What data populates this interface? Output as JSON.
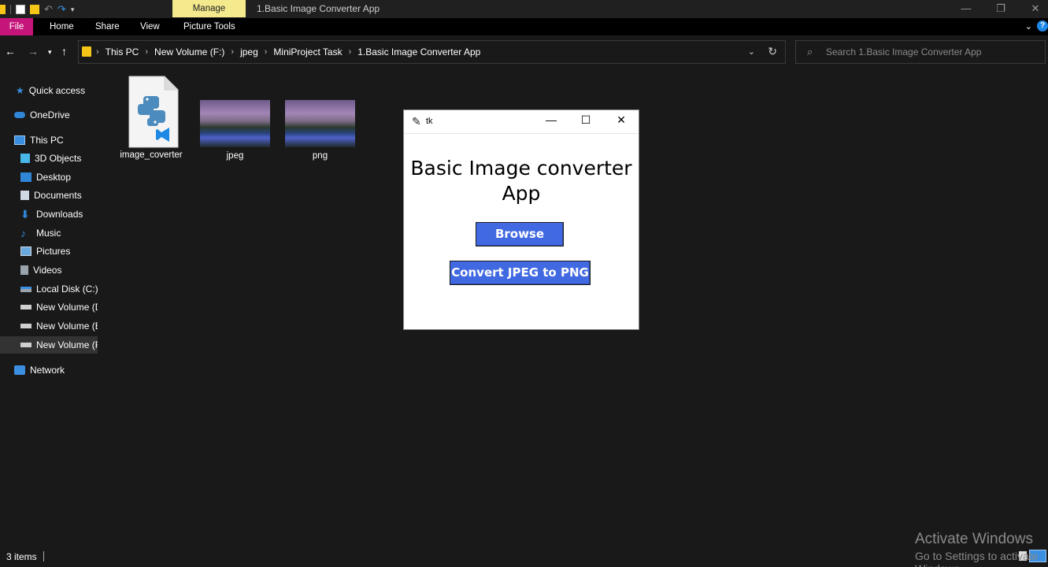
{
  "titlebar": {
    "manage_tab": "Manage",
    "window_title": "1.Basic Image Converter App",
    "minimize": "—",
    "restore": "❐",
    "close": "✕"
  },
  "ribbon": {
    "tabs": [
      "File",
      "Home",
      "Share",
      "View",
      "Picture Tools"
    ]
  },
  "address": {
    "crumbs": [
      "This PC",
      "New Volume (F:)",
      "jpeg",
      "MiniProject Task",
      "1.Basic Image Converter App"
    ],
    "search_placeholder": "Search 1.Basic Image Converter App"
  },
  "sidebar": {
    "items": [
      {
        "label": "Quick access",
        "icon": "star-icon"
      },
      {
        "label": "OneDrive",
        "icon": "cloud-icon"
      },
      {
        "label": "This PC",
        "icon": "computer-icon"
      },
      {
        "label": "3D Objects",
        "icon": "cube-icon"
      },
      {
        "label": "Desktop",
        "icon": "desktop-icon"
      },
      {
        "label": "Documents",
        "icon": "document-icon"
      },
      {
        "label": "Downloads",
        "icon": "download-icon"
      },
      {
        "label": "Music",
        "icon": "music-icon"
      },
      {
        "label": "Pictures",
        "icon": "pictures-icon"
      },
      {
        "label": "Videos",
        "icon": "video-icon"
      },
      {
        "label": "Local Disk (C:)",
        "icon": "drive-icon"
      },
      {
        "label": "New Volume (D:)",
        "icon": "drive-icon"
      },
      {
        "label": "New Volume (E:)",
        "icon": "drive-icon"
      },
      {
        "label": "New Volume (F:)",
        "icon": "drive-icon"
      },
      {
        "label": "Network",
        "icon": "network-icon"
      }
    ]
  },
  "files": [
    {
      "name": "image_coverter",
      "type": "python-file-icon"
    },
    {
      "name": "jpeg",
      "type": "folder-thumbnail"
    },
    {
      "name": "png",
      "type": "folder-thumbnail"
    }
  ],
  "status": {
    "count": "3 items"
  },
  "watermark": {
    "line1": "Activate Windows",
    "line2": "Go to Settings to activate Windows."
  },
  "tk_window": {
    "title": "tk",
    "heading": "Basic Image converter App",
    "browse_label": "Browse",
    "convert_label": "Convert JPEG to PNG"
  },
  "colors": {
    "accent_button": "#4169e1",
    "file_tab": "#c5157a",
    "manage_tab": "#f4e98d"
  }
}
